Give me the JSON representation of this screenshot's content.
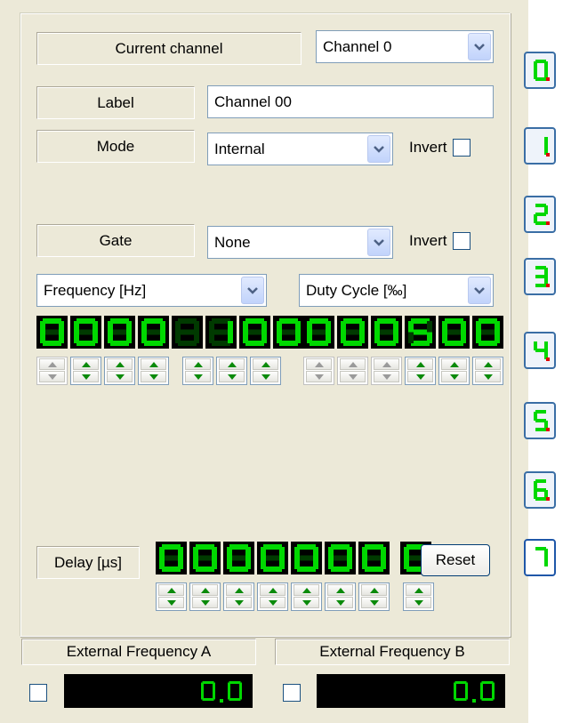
{
  "current_channel": {
    "label": "Current channel",
    "value": "Channel 0"
  },
  "label_row": {
    "label": "Label",
    "value": "Channel 00"
  },
  "mode_row": {
    "label": "Mode",
    "value": "Internal",
    "invert_label": "Invert",
    "invert_checked": false
  },
  "gate_row": {
    "label": "Gate",
    "value": "None",
    "invert_label": "Invert",
    "invert_checked": false
  },
  "frequency": {
    "unit_select": "Frequency [Hz]",
    "digits": [
      "0",
      "0",
      "0",
      "0",
      " ",
      "1",
      "0",
      "0"
    ]
  },
  "duty_cycle": {
    "unit_select": "Duty Cycle [‰]",
    "digits": [
      "0",
      "0",
      "0",
      "5",
      "0",
      "0"
    ]
  },
  "delay": {
    "label": "Delay [µs]",
    "digits": [
      "0",
      "0",
      "0",
      "0",
      "0",
      "0",
      "0",
      "0"
    ],
    "reset_label": "Reset"
  },
  "external": {
    "a": {
      "label": "External Frequency A",
      "value": "0.0",
      "checked": false
    },
    "b": {
      "label": "External Frequency B",
      "value": "0.0",
      "checked": false
    }
  },
  "channel_buttons": [
    "0.",
    "1.",
    "2.",
    "3.",
    "4.",
    "5.",
    "6.",
    "7"
  ],
  "colors": {
    "segment_on": "#00d800",
    "segment_off": "#003a00",
    "dot": "#e00000",
    "panel": "#ece9d8"
  }
}
